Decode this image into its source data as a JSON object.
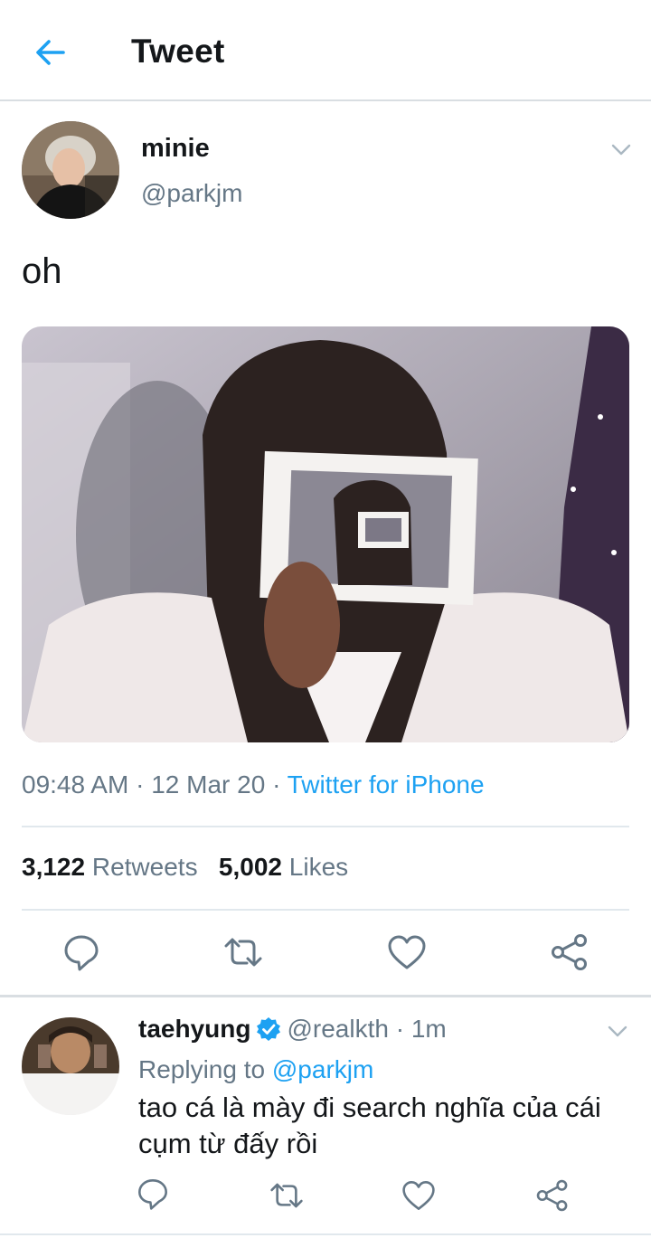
{
  "header": {
    "title": "Tweet"
  },
  "tweet": {
    "author_name": "minie",
    "author_handle": "@parkjm",
    "text": "oh",
    "time": "09:48 AM",
    "date": "12 Mar 20",
    "separator": "·",
    "source": "Twitter for iPhone",
    "retweet_count": "3,122",
    "retweet_label": "Retweets",
    "like_count": "5,002",
    "like_label": "Likes"
  },
  "reply": {
    "author_name": "taehyung",
    "author_handle": "@realkth",
    "time": "1m",
    "separator": "·",
    "replying_label": "Replying to",
    "replying_handle": "@parkjm",
    "text": "tao cá là mày đi search nghĩa của cái cụm từ đấy rồi"
  },
  "colors": {
    "accent": "#1da1f2",
    "muted": "#657786",
    "text": "#14171a",
    "divider": "#e1e8ed"
  },
  "icons": [
    "arrow-left-icon",
    "chevron-down-icon",
    "reply-icon",
    "retweet-icon",
    "like-icon",
    "share-icon",
    "verified-icon"
  ]
}
